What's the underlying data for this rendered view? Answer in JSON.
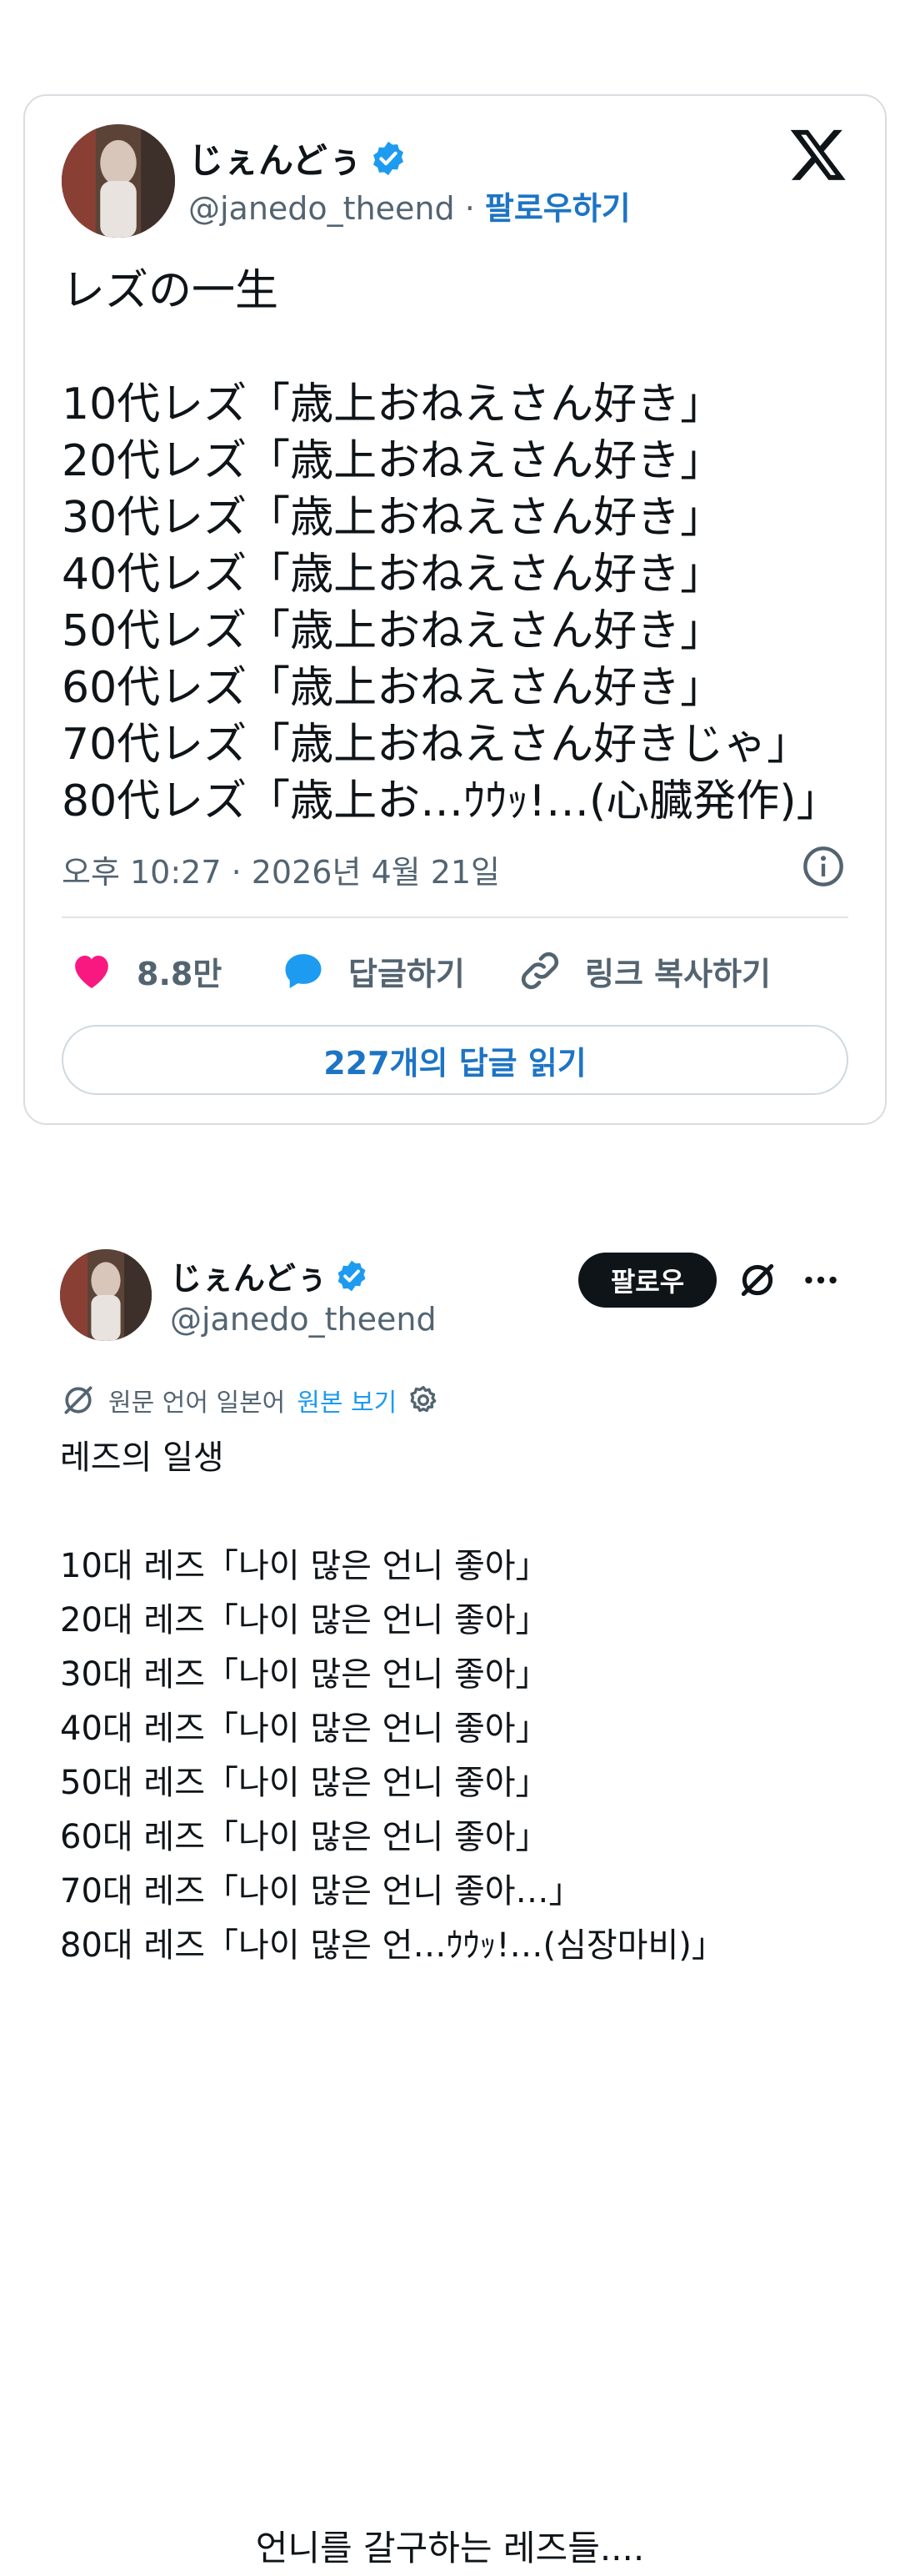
{
  "embed": {
    "display_name": "じぇんどぅ",
    "handle": "@janedo_theend",
    "separator": " · ",
    "follow_label": "팔로우하기",
    "body": "レズの一生\n\n10代レズ「歳上おねえさん好き」\n20代レズ「歳上おねえさん好き」\n30代レズ「歳上おねえさん好き」\n40代レズ「歳上おねえさん好き」\n50代レズ「歳上おねえさん好き」\n60代レズ「歳上おねえさん好き」\n70代レズ「歳上おねえさん好きじゃ」\n80代レズ「歳上お…ｳｳｯ!…(心臓発作)」",
    "timestamp": "오후 10:27 · 2026년 4월 21일",
    "like_count": "8.8만",
    "reply_label": "답글하기",
    "copy_link_label": "링크 복사하기",
    "read_replies_label": "227개의 답글 읽기"
  },
  "translated_post": {
    "display_name": "じぇんどぅ",
    "handle": "@janedo_theend",
    "follow_label": "팔로우",
    "translation_note": "원문 언어 일본어",
    "show_original_label": "원본 보기",
    "body": "레즈의 일생\n\n10대 레즈「나이 많은 언니 좋아」\n20대 레즈「나이 많은 언니 좋아」\n30대 레즈「나이 많은 언니 좋아」\n40대 레즈「나이 많은 언니 좋아」\n50대 레즈「나이 많은 언니 좋아」\n60대 레즈「나이 많은 언니 좋아」\n70대 레즈「나이 많은 언니 좋아…」\n80대 레즈「나이 많은 언…ｳｳｯ!…(심장마비)」"
  },
  "caption": "언니를 갈구하는 레즈들....",
  "colors": {
    "link_blue": "#1d74c4",
    "verified_blue": "#1d9bf0",
    "like_pink": "#f91880",
    "reply_blue": "#1d9bf0",
    "follow_button_bg": "#0f1419"
  },
  "icons": [
    "verified-badge-icon",
    "x-logo-icon",
    "info-icon",
    "heart-icon",
    "reply-bubble-icon",
    "link-icon",
    "grok-icon",
    "more-icon",
    "translate-icon",
    "settings-icon"
  ]
}
